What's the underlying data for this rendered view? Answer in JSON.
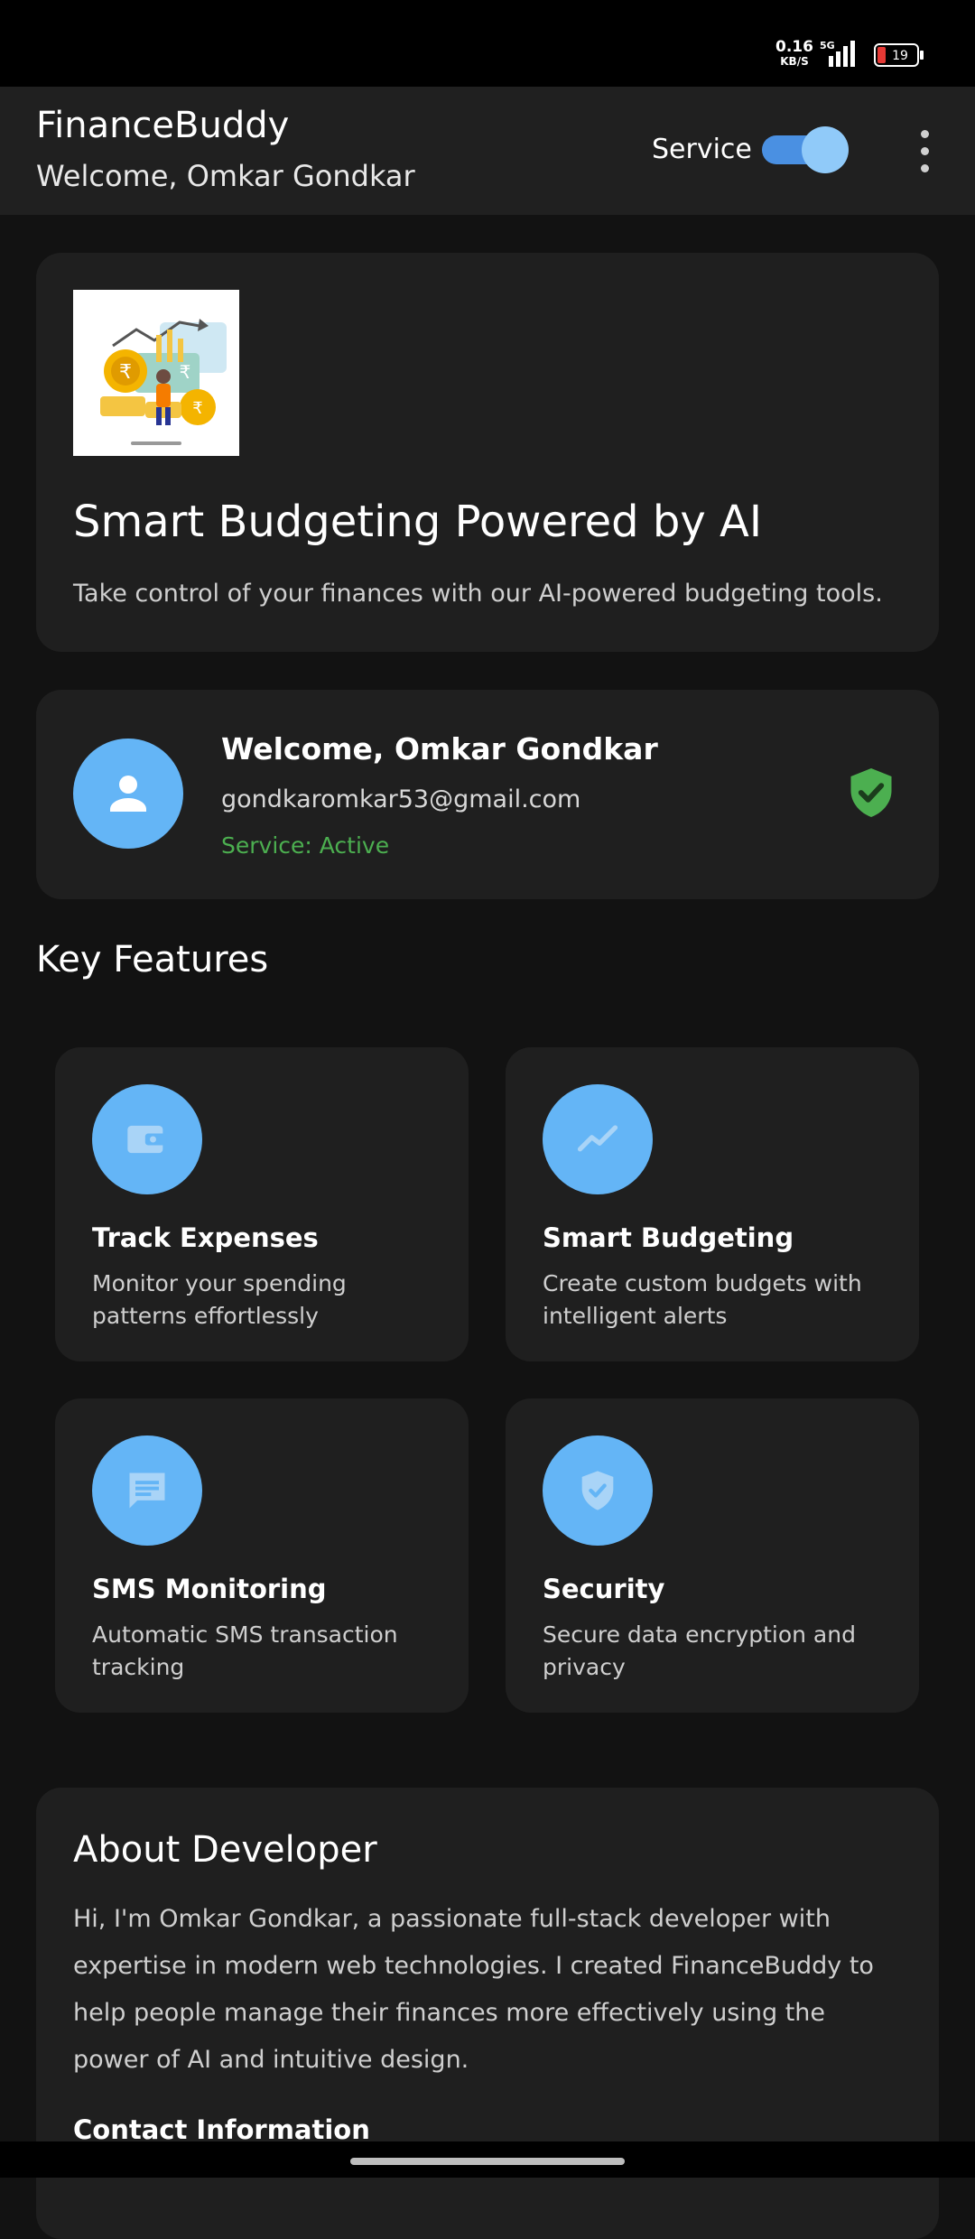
{
  "status_bar": {
    "net_speed_value": "0.16",
    "net_speed_unit": "KB/S",
    "network_type": "5G",
    "battery_level": "19"
  },
  "app_bar": {
    "title": "FinanceBuddy",
    "subtitle": "Welcome, Omkar Gondkar",
    "service_label": "Service",
    "service_enabled": true,
    "menu_icon": "more-vert-icon"
  },
  "hero": {
    "image_icon": "finance-illustration",
    "title": "Smart Budgeting Powered by AI",
    "description": "Take control of your finances with our AI-powered budgeting tools."
  },
  "profile": {
    "avatar_icon": "person-icon",
    "name": "Welcome, Omkar Gondkar",
    "email": "gondkaromkar53@gmail.com",
    "status": "Service: Active",
    "status_color": "#4caf50",
    "badge_icon": "verified-shield-icon"
  },
  "features": {
    "section_title": "Key Features",
    "items": [
      {
        "icon": "wallet-icon",
        "title": "Track Expenses",
        "description": "Monitor your spending patterns effortlessly"
      },
      {
        "icon": "trending-up-icon",
        "title": "Smart Budgeting",
        "description": "Create custom budgets with intelligent alerts"
      },
      {
        "icon": "message-icon",
        "title": "SMS Monitoring",
        "description": "Automatic SMS transaction tracking"
      },
      {
        "icon": "shield-icon",
        "title": "Security",
        "description": "Secure data encryption and privacy"
      }
    ]
  },
  "about": {
    "title": "About Developer",
    "text": "Hi, I'm Omkar Gondkar, a passionate full-stack developer with expertise in modern web technologies. I created FinanceBuddy to help people manage their finances more effectively using the power of AI and intuitive design.",
    "contact_title": "Contact Information"
  },
  "colors": {
    "accent": "#64b5f6",
    "background": "#121212",
    "card": "#1f1f1f",
    "success": "#4caf50"
  }
}
